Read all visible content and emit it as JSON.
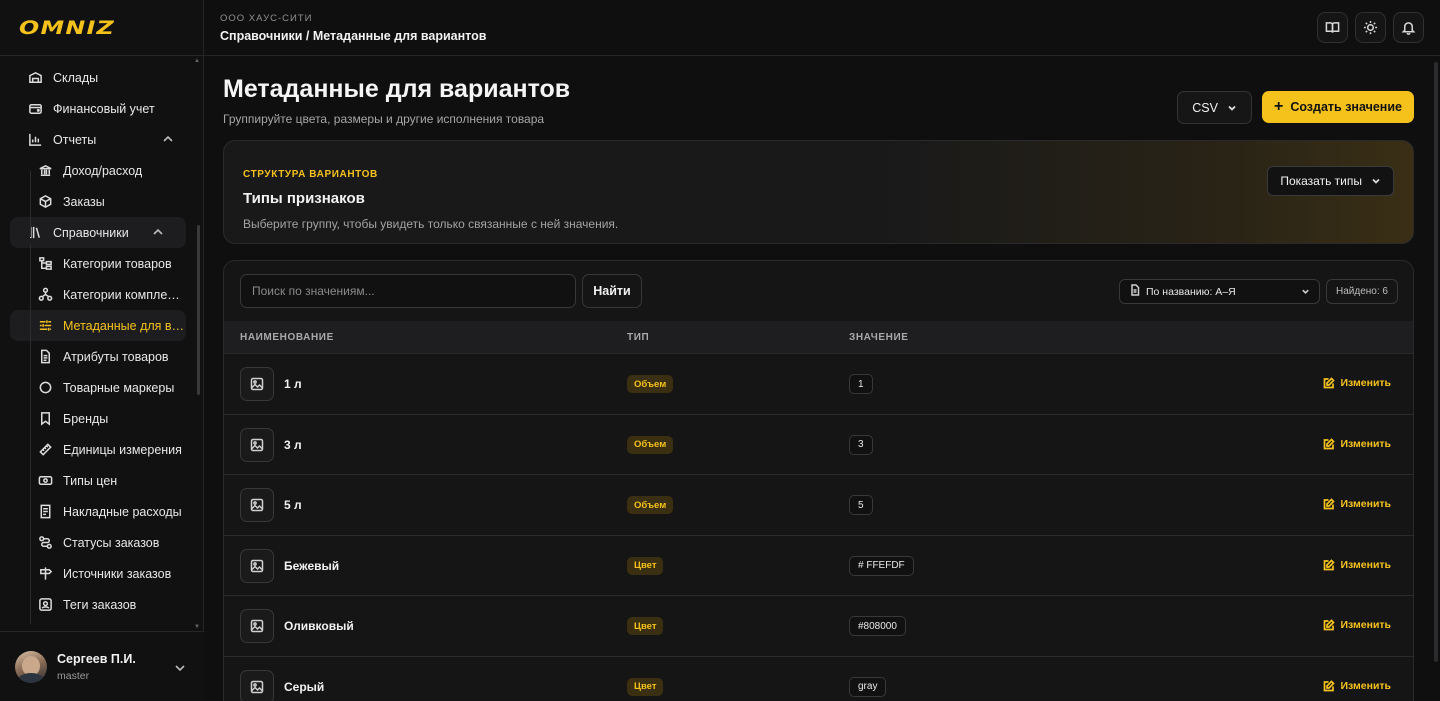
{
  "brand": {
    "logo": "OMNIZ",
    "accent": "#f5c21b"
  },
  "sidebar": {
    "items": [
      {
        "label": "Склады",
        "icon": "warehouse-icon",
        "level": "top"
      },
      {
        "label": "Финансовый учет",
        "icon": "wallet-icon",
        "level": "top"
      },
      {
        "label": "Отчеты",
        "icon": "chart-icon",
        "level": "top",
        "expanded": true
      },
      {
        "label": "Доход/расход",
        "icon": "bank-icon",
        "level": "sub"
      },
      {
        "label": "Заказы",
        "icon": "box-icon",
        "level": "sub"
      },
      {
        "label": "Справочники",
        "icon": "library-icon",
        "level": "top",
        "expanded": true
      },
      {
        "label": "Категории товаров",
        "icon": "tree-icon",
        "level": "sub"
      },
      {
        "label": "Категории компле…",
        "icon": "network-icon",
        "level": "sub"
      },
      {
        "label": "Метаданные для в…",
        "icon": "sliders-icon",
        "level": "sub",
        "active": true
      },
      {
        "label": "Атрибуты товаров",
        "icon": "document-icon",
        "level": "sub"
      },
      {
        "label": "Товарные маркеры",
        "icon": "circle-icon",
        "level": "sub"
      },
      {
        "label": "Бренды",
        "icon": "bookmark-icon",
        "level": "sub"
      },
      {
        "label": "Единицы измерения",
        "icon": "ruler-icon",
        "level": "sub"
      },
      {
        "label": "Типы цен",
        "icon": "banknote-icon",
        "level": "sub"
      },
      {
        "label": "Накладные расходы",
        "icon": "receipt-icon",
        "level": "sub"
      },
      {
        "label": "Статусы заказов",
        "icon": "route-icon",
        "level": "sub"
      },
      {
        "label": "Источники заказов",
        "icon": "signpost-icon",
        "level": "sub"
      },
      {
        "label": "Теги заказов",
        "icon": "tag-icon",
        "level": "sub"
      }
    ]
  },
  "user": {
    "name": "Сергеев П.И.",
    "role": "master"
  },
  "topbar": {
    "org": "ООО ХАУС-СИТИ",
    "breadcrumb": "Справочники / Метаданные для вариантов"
  },
  "page": {
    "title": "Метаданные для вариантов",
    "subtitle": "Группируйте цвета, размеры и другие исполнения товара",
    "csv_label": "CSV",
    "create_label": "Создать значение"
  },
  "types_card": {
    "eyebrow": "СТРУКТУРА ВАРИАНТОВ",
    "title": "Типы признаков",
    "description": "Выберите группу, чтобы увидеть только связанные с ней значения.",
    "show_label": "Показать типы"
  },
  "table": {
    "search_placeholder": "Поиск по значениям...",
    "find_label": "Найти",
    "sort_label": "По названию: А–Я",
    "found_label": "Найдено: 6",
    "columns": {
      "name": "НАИМЕНОВАНИЕ",
      "type": "ТИП",
      "value": "ЗНАЧЕНИЕ"
    },
    "edit_label": "Изменить",
    "rows": [
      {
        "name": "1 л",
        "type": "Объем",
        "value": "1"
      },
      {
        "name": "3 л",
        "type": "Объем",
        "value": "3"
      },
      {
        "name": "5 л",
        "type": "Объем",
        "value": "5"
      },
      {
        "name": "Бежевый",
        "type": "Цвет",
        "value": "# FFEFDF"
      },
      {
        "name": "Оливковый",
        "type": "Цвет",
        "value": "#808000"
      },
      {
        "name": "Серый",
        "type": "Цвет",
        "value": "gray"
      }
    ]
  }
}
